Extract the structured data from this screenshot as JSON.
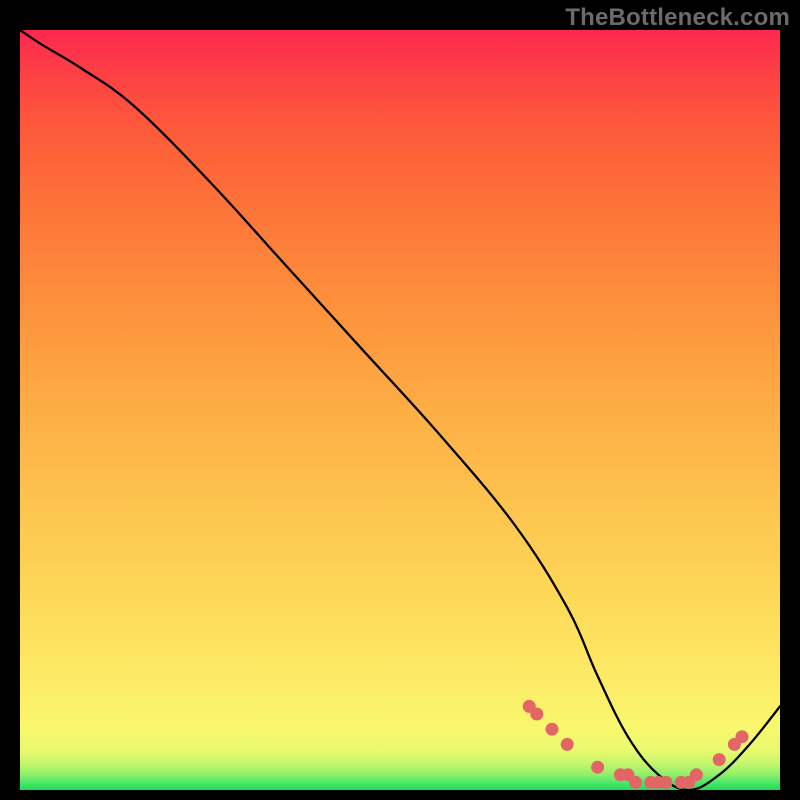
{
  "watermark": "TheBottleneck.com",
  "chart_data": {
    "type": "line",
    "title": "",
    "xlabel": "",
    "ylabel": "",
    "xlim": [
      0,
      100
    ],
    "ylim": [
      0,
      100
    ],
    "x": [
      0,
      3,
      8,
      15,
      25,
      35,
      45,
      55,
      65,
      72,
      76,
      80,
      84,
      88,
      92,
      96,
      100
    ],
    "values": [
      100,
      98,
      95,
      90,
      80,
      69,
      58,
      47,
      35,
      24,
      15,
      7,
      2,
      0,
      2,
      6,
      11
    ],
    "annotation_band_y": [
      0,
      14
    ],
    "dot_points_x": [
      67,
      68,
      70,
      72,
      76,
      79,
      80,
      81,
      83,
      84,
      85,
      87,
      88,
      89,
      92,
      94,
      95
    ],
    "dot_points_y": [
      11,
      10,
      8,
      6,
      3,
      2,
      2,
      1,
      1,
      1,
      1,
      1,
      1,
      2,
      4,
      6,
      7
    ]
  }
}
